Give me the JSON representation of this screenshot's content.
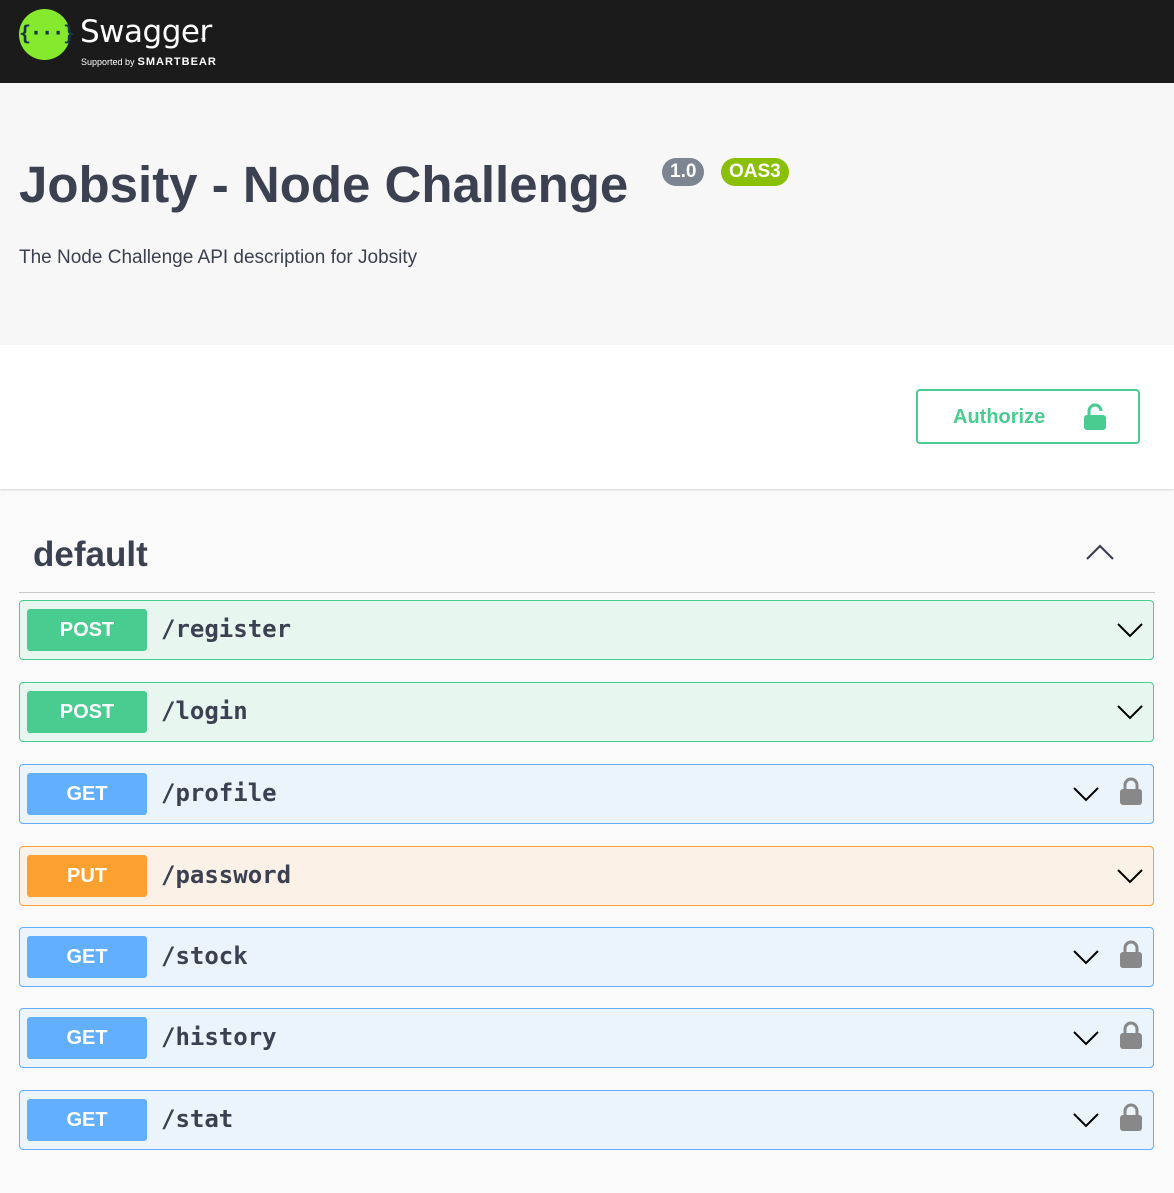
{
  "topbar": {
    "logo_name": "Swagger",
    "logo_tm": "™",
    "supported_by": "Supported by",
    "vendor": "SMARTBEAR"
  },
  "info": {
    "title": "Jobsity - Node Challenge",
    "version": "1.0",
    "oas": "OAS3",
    "description": "The Node Challenge API description for Jobsity"
  },
  "scheme": {
    "authorize_label": "Authorize"
  },
  "tag": {
    "name": "default",
    "expanded": true
  },
  "operations": [
    {
      "method": "POST",
      "path": "/register",
      "locked": false
    },
    {
      "method": "POST",
      "path": "/login",
      "locked": false
    },
    {
      "method": "GET",
      "path": "/profile",
      "locked": true
    },
    {
      "method": "PUT",
      "path": "/password",
      "locked": false
    },
    {
      "method": "GET",
      "path": "/stock",
      "locked": true
    },
    {
      "method": "GET",
      "path": "/history",
      "locked": true
    },
    {
      "method": "GET",
      "path": "/stat",
      "locked": true
    }
  ],
  "colors": {
    "post": "#49cc90",
    "get": "#61affe",
    "put": "#fca130",
    "topbar": "#1b1b1b",
    "logo": "#85ea2d"
  },
  "icons": {
    "authorize": "unlocked-lock-icon",
    "operation_lock": "locked-lock-icon",
    "collapse": "chevron-up-icon",
    "expand": "chevron-down-icon"
  }
}
